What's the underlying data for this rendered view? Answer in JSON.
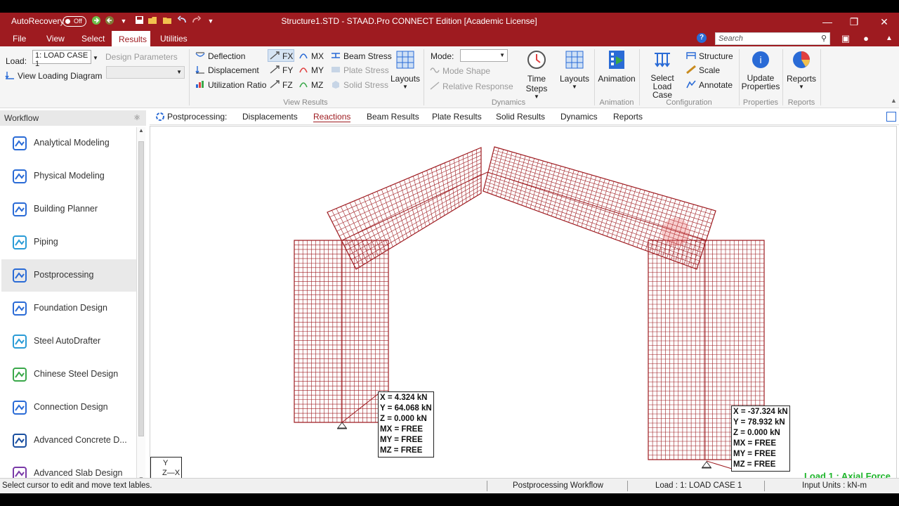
{
  "titlebar": {
    "autorecovery_label": "AutoRecovery",
    "toggle_state": "Off",
    "title": "Structure1.STD - STAAD.Pro CONNECT Edition [Academic License]"
  },
  "menu": {
    "tabs": [
      "File",
      "View",
      "Select",
      "Results",
      "Utilities"
    ],
    "active_tab": "Results",
    "search_placeholder": "Search"
  },
  "ribbon": {
    "load_label": "Load:",
    "load_value": "1: LOAD CASE 1",
    "view_loading_diagram": "View Loading Diagram",
    "design_parameters": "Design Parameters",
    "view_results": {
      "deflection": "Deflection",
      "displacement": "Displacement",
      "utilization_ratio": "Utilization Ratio",
      "fx": "FX",
      "fy": "FY",
      "fz": "FZ",
      "mx": "MX",
      "my": "MY",
      "mz": "MZ",
      "beam_stress": "Beam Stress",
      "plate_stress": "Plate Stress",
      "solid_stress": "Solid Stress",
      "layouts": "Layouts",
      "group_label": "View Results"
    },
    "dynamics": {
      "mode_label": "Mode:",
      "mode_shape": "Mode Shape",
      "relative_response": "Relative Response",
      "time_steps": "Time Steps",
      "layouts": "Layouts",
      "group_label": "Dynamics"
    },
    "animation": {
      "label": "Animation",
      "group_label": "Animation"
    },
    "configuration": {
      "select_load_case_1": "Select",
      "select_load_case_2": "Load Case",
      "structure": "Structure",
      "scale": "Scale",
      "annotate": "Annotate",
      "group_label": "Configuration"
    },
    "properties": {
      "label_1": "Update",
      "label_2": "Properties",
      "group_label": "Properties"
    },
    "reports": {
      "label": "Reports",
      "group_label": "Reports"
    }
  },
  "sidebar": {
    "header": "Workflow",
    "items": [
      {
        "label": "Analytical Modeling",
        "color": "#2a6bd6"
      },
      {
        "label": "Physical Modeling",
        "color": "#2a6bd6"
      },
      {
        "label": "Building Planner",
        "color": "#2a6bd6"
      },
      {
        "label": "Piping",
        "color": "#2a9bd6"
      },
      {
        "label": "Postprocessing",
        "color": "#2a6bd6"
      },
      {
        "label": "Foundation Design",
        "color": "#2a6bd6"
      },
      {
        "label": "Steel AutoDrafter",
        "color": "#2a9bd6"
      },
      {
        "label": "Chinese Steel Design",
        "color": "#3aa84a"
      },
      {
        "label": "Connection Design",
        "color": "#2a6bd6"
      },
      {
        "label": "Advanced Concrete D...",
        "color": "#1a4fa0"
      },
      {
        "label": "Advanced Slab Design",
        "color": "#7a3aa8"
      }
    ],
    "active_index": 4
  },
  "pp_tabs": {
    "label": "Postprocessing:",
    "tabs": [
      "Displacements",
      "Reactions",
      "Beam Results",
      "Plate Results",
      "Solid Results",
      "Dynamics",
      "Reports"
    ],
    "active_tab": "Reactions"
  },
  "viewport": {
    "reaction_left": [
      "X = 4.324 kN",
      "Y = 64.068 kN",
      "Z = 0.000 kN",
      "MX = FREE",
      "MY = FREE",
      "MZ = FREE"
    ],
    "reaction_right": [
      "X = -37.324 kN",
      "Y = 78.932 kN",
      "Z = 0.000 kN",
      "MX = FREE",
      "MY = FREE",
      "MZ = FREE"
    ],
    "load_caption": "Load 1 : Axial Force",
    "axis_y": "Y",
    "axis_zx": "Z—X",
    "mesh_color": "#9e1b20",
    "caption_color": "#1db52a"
  },
  "status": {
    "hint": "Select cursor to edit and move text lables.",
    "workflow": "Postprocessing Workflow",
    "load": "Load : 1: LOAD CASE 1",
    "units": "Input Units : kN-m"
  },
  "colors": {
    "accent": "#9e1b20",
    "ribbon_bg": "#f5f5f5"
  }
}
